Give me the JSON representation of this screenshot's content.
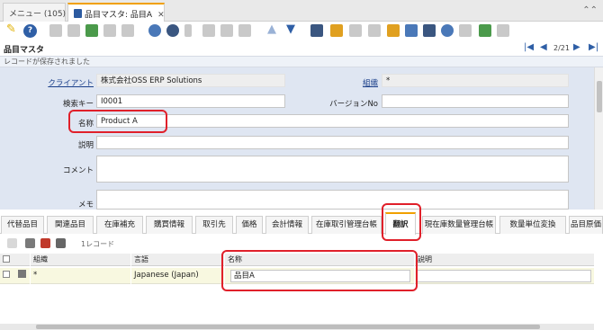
{
  "window_tabs": [
    {
      "label": "メニュー (105)"
    },
    {
      "label": "品目マスタ: 品目A"
    }
  ],
  "header": {
    "title": "品目マスタ",
    "page": "2/21"
  },
  "status_message": "レコードが保存されました",
  "form": {
    "client_label": "クライアント",
    "client_value": "株式会社OSS ERP Solutions",
    "org_label": "組織",
    "org_value": "*",
    "search_key_label": "検索キー",
    "search_key_value": "I0001",
    "version_label": "バージョンNo",
    "version_value": "",
    "name_label": "名称",
    "name_value": "Product A",
    "description_label": "説明",
    "description_value": "",
    "comment_label": "コメント",
    "comment_value": "",
    "memo_label": "メモ",
    "memo_value": ""
  },
  "detail_tabs": [
    {
      "label": "代替品目"
    },
    {
      "label": "関連品目"
    },
    {
      "label": "在庫補充"
    },
    {
      "label": "購買情報"
    },
    {
      "label": "取引先"
    },
    {
      "label": "価格"
    },
    {
      "label": "会計情報"
    },
    {
      "label": "在庫取引管理台帳"
    },
    {
      "label": "翻訳"
    },
    {
      "label": "現在庫数量管理台帳"
    },
    {
      "label": "数量単位変換"
    },
    {
      "label": "品目原価"
    }
  ],
  "grid": {
    "record_count": "1レコード",
    "columns": [
      "組織",
      "言語",
      "名称",
      "説明"
    ],
    "rows": [
      {
        "org": "*",
        "language": "Japanese (Japan)",
        "name": "品目A",
        "description": ""
      }
    ]
  },
  "colors": {
    "accent": "#f0a000",
    "highlight": "#e0202a",
    "link": "#1a3f8a",
    "form_bg": "#dfe6f2"
  }
}
